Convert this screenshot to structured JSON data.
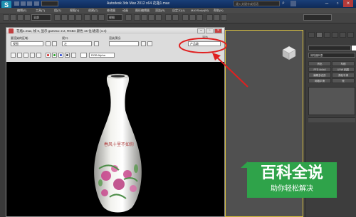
{
  "app": {
    "logo": "S",
    "title": "Autodesk 3ds Max 2012 x64   花瓶1.max",
    "search_placeholder": "键入关键字或短语",
    "colors": {
      "titlebar": "#163770",
      "highlight_circle": "#e02020",
      "viewport_border": "#d8c040",
      "watermark_green": "#2fa34a"
    }
  },
  "menubar": {
    "items": [
      "编辑(E)",
      "工具(T)",
      "组(G)",
      "视图(V)",
      "创建(C)",
      "修改器",
      "动画",
      "图形编辑器",
      "渲染(R)",
      "自定义(U)",
      "MAXScript(M)",
      "帮助(H)"
    ]
  },
  "toolbar": {
    "select_all": "全部",
    "select_view": "视图"
  },
  "render_window": {
    "title": "花瓶1.max, 帧 0, 显示 gamma: 2.2, RGBA 颜色 16 位/通道 (1:4)",
    "area_label": "要渲染的区域:",
    "area_value": "视图",
    "viewport_label": "视口:",
    "viewport_value": "左",
    "preset_label": "渲染预设:",
    "preset_value": "",
    "render_label": "渲染",
    "render_value": "产品级",
    "channel_value": "RGB Alpha",
    "icons": [
      "save-icon",
      "copy-icon",
      "clone-icon",
      "print-icon",
      "clear-icon",
      "red-channel-icon",
      "green-channel-icon",
      "blue-channel-icon",
      "alpha-channel-icon",
      "mono-icon"
    ]
  },
  "vase": {
    "inscription": "春风十里不如你",
    "colors": {
      "porcelain": "#f4f4ef",
      "flower": "#c8408a",
      "leaf": "#4f8f4a"
    }
  },
  "command_panel": {
    "dropdown": "修改器列表",
    "buttons": [
      "挤出",
      "车削",
      "FFD 4x4x4",
      "UVW 贴图",
      "编辑多边形",
      "涡轮平滑",
      "网格平滑",
      "壳"
    ]
  },
  "watermark": {
    "title": "百科全说",
    "subtitle": "助你轻松解决"
  }
}
